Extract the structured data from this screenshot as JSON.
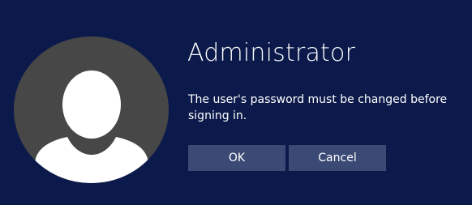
{
  "dialog": {
    "username": "Administrator",
    "message": "The user's password must be changed before signing in.",
    "ok_label": "OK",
    "cancel_label": "Cancel"
  },
  "colors": {
    "background": "#0b1a4a",
    "avatar_bg": "#474747",
    "button_bg": "#3b4a75",
    "text": "#ffffff"
  },
  "icons": {
    "avatar": "user-avatar-icon"
  }
}
